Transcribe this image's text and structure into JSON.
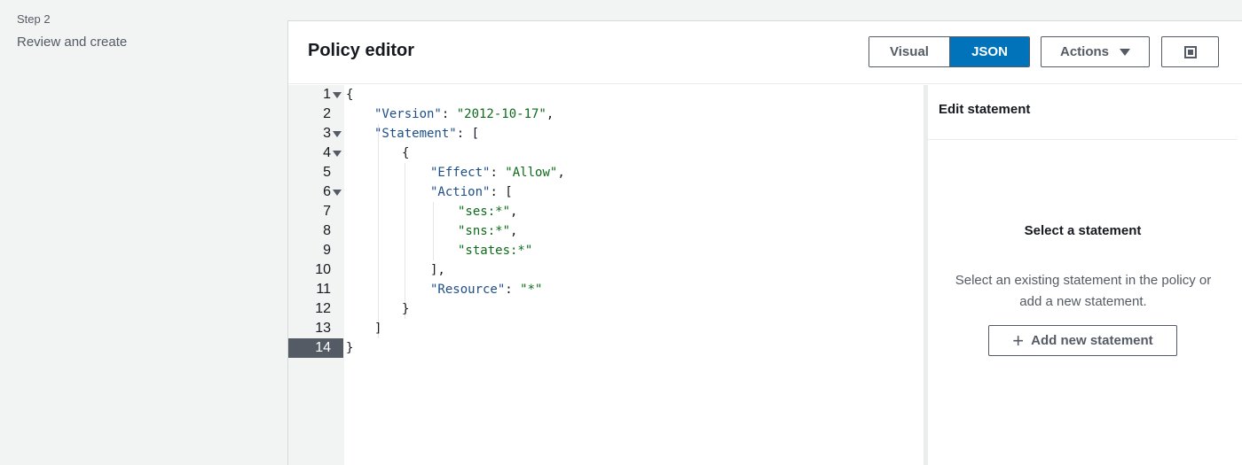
{
  "steps": {
    "label": "Step 2",
    "title": "Review and create"
  },
  "editor": {
    "title": "Policy editor",
    "tabs": {
      "visual": "Visual",
      "json": "JSON",
      "active": "JSON"
    },
    "actions_label": "Actions",
    "active_line": "14",
    "lines": [
      "1",
      "2",
      "3",
      "4",
      "5",
      "6",
      "7",
      "8",
      "9",
      "10",
      "11",
      "12",
      "13",
      "14"
    ],
    "code": {
      "l1": "{",
      "l2k": "\"Version\"",
      "l2v": "\"2012-10-17\"",
      "l3k": "\"Statement\"",
      "l3p": ": [",
      "l4": "{",
      "l5k": "\"Effect\"",
      "l5v": "\"Allow\"",
      "l6k": "\"Action\"",
      "l6p": ": [",
      "l7": "\"ses:*\"",
      "l8": "\"sns:*\"",
      "l9": "\"states:*\"",
      "l10": "],",
      "l11k": "\"Resource\"",
      "l11v": "\"*\"",
      "l12": "}",
      "l13": "]",
      "l14": "}"
    }
  },
  "side_panel": {
    "title": "Edit statement",
    "empty_title": "Select a statement",
    "empty_desc": "Select an existing statement in the policy or add a new statement.",
    "add_label": "Add new statement"
  }
}
